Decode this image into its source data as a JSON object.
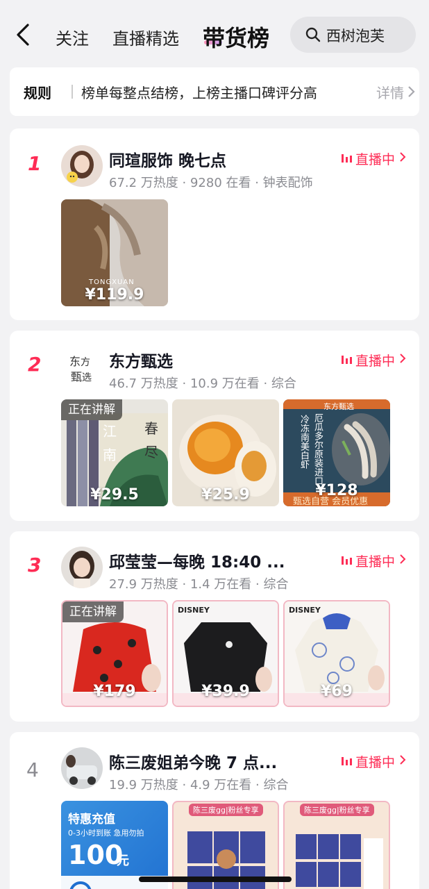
{
  "header": {
    "tabs": [
      "关注",
      "直播精选",
      "带货榜"
    ],
    "search_text": "西树泡芙"
  },
  "rules": {
    "title": "规则",
    "text": "榜单每整点结榜，上榜主播口碑评分高",
    "detail": "详情"
  },
  "live_label": "直播中",
  "cards": [
    {
      "rank": "1",
      "name": "同瑄服饰 晚七点",
      "meta": "67.2 万热度 · 9280 在看 · 钟表配饰",
      "products": [
        {
          "price": "¥119.9",
          "brand": "TONGXUAN",
          "explaining": ""
        }
      ]
    },
    {
      "rank": "2",
      "name": "东方甄选",
      "meta": "46.7 万热度 · 10.9 万在看 · 综合",
      "products": [
        {
          "price": "¥29.5",
          "explaining": "正在讲解"
        },
        {
          "price": "¥25.9",
          "explaining": ""
        },
        {
          "price": "¥128",
          "explaining": ""
        }
      ]
    },
    {
      "rank": "3",
      "name": "邱莹莹—每晚 18:40 ...",
      "meta": "27.9 万热度 · 1.4 万在看 · 综合",
      "products": [
        {
          "price": "¥179",
          "explaining": "正在讲解"
        },
        {
          "price": "¥39.9",
          "explaining": ""
        },
        {
          "price": "¥69",
          "explaining": ""
        }
      ]
    },
    {
      "rank": "4",
      "name": "陈三废姐弟今晚 7 点...",
      "meta": "19.9 万热度 · 4.9 万在看 · 综合",
      "products": [
        {
          "price": "",
          "promo_title": "特惠充值",
          "promo_sub": "0-3小时到账 急用勿拍",
          "promo_amount": "100",
          "promo_unit": "元"
        },
        {
          "price": "",
          "tag": "陈三废gg|粉丝专享"
        },
        {
          "price": "",
          "tag": "陈三废gg|粉丝专享"
        }
      ]
    }
  ],
  "product_texts": {
    "c2p1_title1": "春",
    "c2p1_title2": "尽",
    "c2p1_title3": "江",
    "c2p1_title4": "南",
    "c2p3_brand": "东方甄选",
    "c2p3_line1": "厄瓜多尔原装进口",
    "c2p3_line2": "冷冻南美白虾",
    "c2p3_bottom": "甄选自营 会员优惠",
    "disney": "DISNEY"
  },
  "colors": {
    "accent": "#fe2c55",
    "background": "#f2f2f4"
  }
}
